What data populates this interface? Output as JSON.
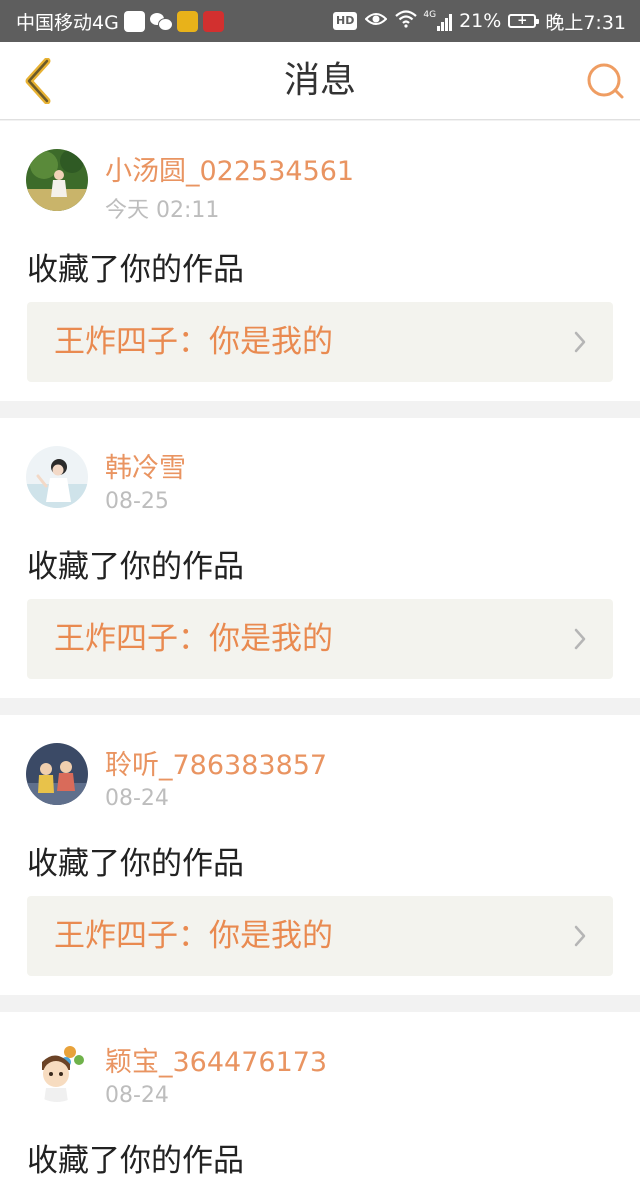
{
  "status_bar": {
    "carrier": "中国移动4G",
    "hd": "HD",
    "network": "4G",
    "battery": "21%",
    "time": "晚上7:31"
  },
  "header": {
    "title": "消息",
    "back_icon": "chevron-left-icon",
    "search_icon": "search-icon"
  },
  "colors": {
    "accent": "#e99461",
    "work_title": "#e98a50",
    "card_bg": "#ffffff",
    "page_bg": "#f2f2f2",
    "work_box_bg": "#f3f3ee"
  },
  "messages": [
    {
      "username": "小汤圆_022534561",
      "time": "今天 02:11",
      "action": "收藏了你的作品",
      "work_title": "王炸四子：你是我的"
    },
    {
      "username": "韩冷雪",
      "time": "08-25",
      "action": "收藏了你的作品",
      "work_title": "王炸四子：你是我的"
    },
    {
      "username": "聆听_786383857",
      "time": "08-24",
      "action": "收藏了你的作品",
      "work_title": "王炸四子：你是我的"
    },
    {
      "username": "颖宝_364476173",
      "time": "08-24",
      "action": "收藏了你的作品"
    }
  ]
}
